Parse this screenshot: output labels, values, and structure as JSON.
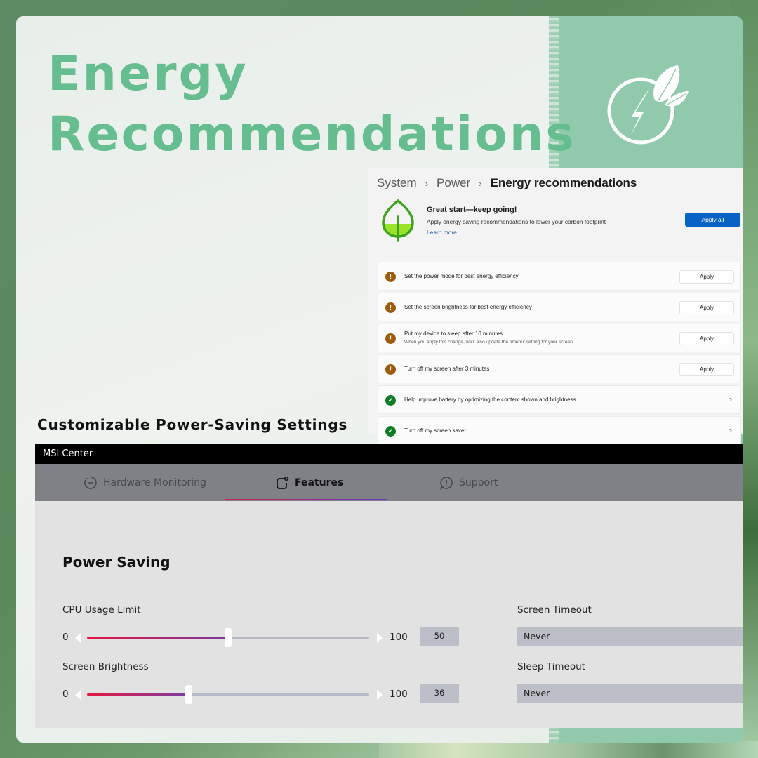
{
  "headline": {
    "line1": "Energy",
    "line2": "Recommendations"
  },
  "colors": {
    "accent_green": "#66bd8f",
    "panel_green": "#90c9ab",
    "apply_all_blue": "#0a62c4",
    "warning": "#9d5c0d",
    "success": "#0f7b25",
    "slider_fill_start": "#e3173d",
    "slider_fill_end": "#7b3aa3"
  },
  "badge_icon": "eco-lightning-leaf-icon",
  "windows_settings": {
    "breadcrumb": [
      "System",
      "Power",
      "Energy recommendations"
    ],
    "hero": {
      "title": "Great start—keep going!",
      "subtitle": "Apply energy saving recommendations to lower your carbon footprint",
      "link": "Learn more",
      "apply_all": "Apply all"
    },
    "recommendations": [
      {
        "text": "Set the power mode for best energy efficiency",
        "status": "warning",
        "action": "Apply"
      },
      {
        "text": "Set the screen brightness for best energy efficiency",
        "status": "warning",
        "action": "Apply"
      },
      {
        "text": "Put my device to sleep after 10 minutes",
        "subtext": "When you apply this change, we'll also update the timeout setting for your screen",
        "status": "warning",
        "action": "Apply"
      },
      {
        "text": "Turn off my screen after 3 minutes",
        "status": "warning",
        "action": "Apply"
      },
      {
        "text": "Help improve battery by optimizing the content shown and brightness",
        "status": "done",
        "action": "chevron"
      },
      {
        "text": "Turn off my screen saver",
        "status": "done",
        "action": "chevron"
      }
    ]
  },
  "section_title": "Customizable Power-Saving Settings",
  "msi_center": {
    "title": "MSI Center",
    "tabs": [
      {
        "label": "Hardware Monitoring",
        "icon": "gauge-icon",
        "active": false
      },
      {
        "label": "Features",
        "icon": "features-icon",
        "active": true
      },
      {
        "label": "Support",
        "icon": "support-icon",
        "active": false
      }
    ],
    "heading": "Power Saving",
    "sliders": [
      {
        "label": "CPU Usage Limit",
        "min": "0",
        "max": "100",
        "value": 50
      },
      {
        "label": "Screen Brightness",
        "min": "0",
        "max": "100",
        "value": 36
      }
    ],
    "selects": [
      {
        "label": "Screen Timeout",
        "value": "Never"
      },
      {
        "label": "Sleep Timeout",
        "value": "Never"
      }
    ]
  }
}
